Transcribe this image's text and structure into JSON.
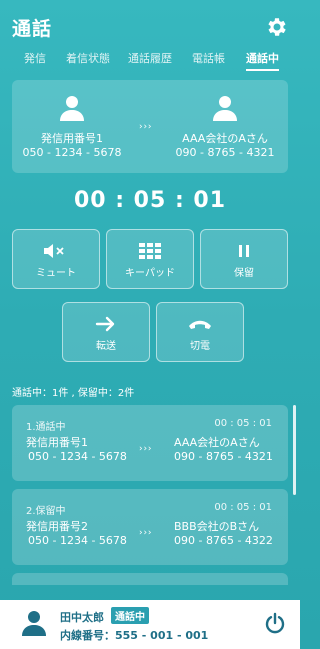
{
  "header": {
    "title": "通話",
    "tabs": [
      {
        "label": "発信"
      },
      {
        "label": "着信状態"
      },
      {
        "label": "通話履歴"
      },
      {
        "label": "電話帳"
      },
      {
        "label": "通話中"
      }
    ],
    "active_tab": "通話中"
  },
  "current_call": {
    "from_name": "発信用番号1",
    "from_number": "050 - 1234 - 5678",
    "to_name": "AAA会社のAさん",
    "to_number": "090 - 8765 - 4321",
    "arrows": "› › ›"
  },
  "timer": "00 : 05 : 01",
  "actions": {
    "mute": "ミュート",
    "keypad": "キーパッド",
    "hold": "保留",
    "transfer": "転送",
    "hangup": "切電"
  },
  "summary": "通話中：1件 , 保留中：2件",
  "calls": [
    {
      "status": "1.通話中",
      "time": "00 : 05 : 01",
      "from_name": "発信用番号1",
      "from_number": "050 - 1234 - 5678",
      "to_name": "AAA会社のAさん",
      "to_number": "090 - 8765 - 4321"
    },
    {
      "status": "2.保留中",
      "time": "00 : 05 : 01",
      "from_name": "発信用番号2",
      "from_number": "050 - 1234 - 5678",
      "to_name": "BBB会社のBさん",
      "to_number": "090 - 8765 - 4322"
    }
  ],
  "footer": {
    "user_name": "田中太郎",
    "status_badge": "通話中",
    "extension": "内線番号：555 - 001 - 001"
  },
  "icons": {
    "settings": "gear-icon",
    "person": "person-icon",
    "mute": "speaker-mute-icon",
    "keypad": "keypad-icon",
    "hold": "pause-icon",
    "transfer": "arrow-right-icon",
    "hangup": "phone-hangup-icon",
    "power": "power-icon"
  },
  "colors": {
    "background": "#2eacb4",
    "footer_text": "#1f6f87",
    "badge": "#2a9fb0"
  }
}
